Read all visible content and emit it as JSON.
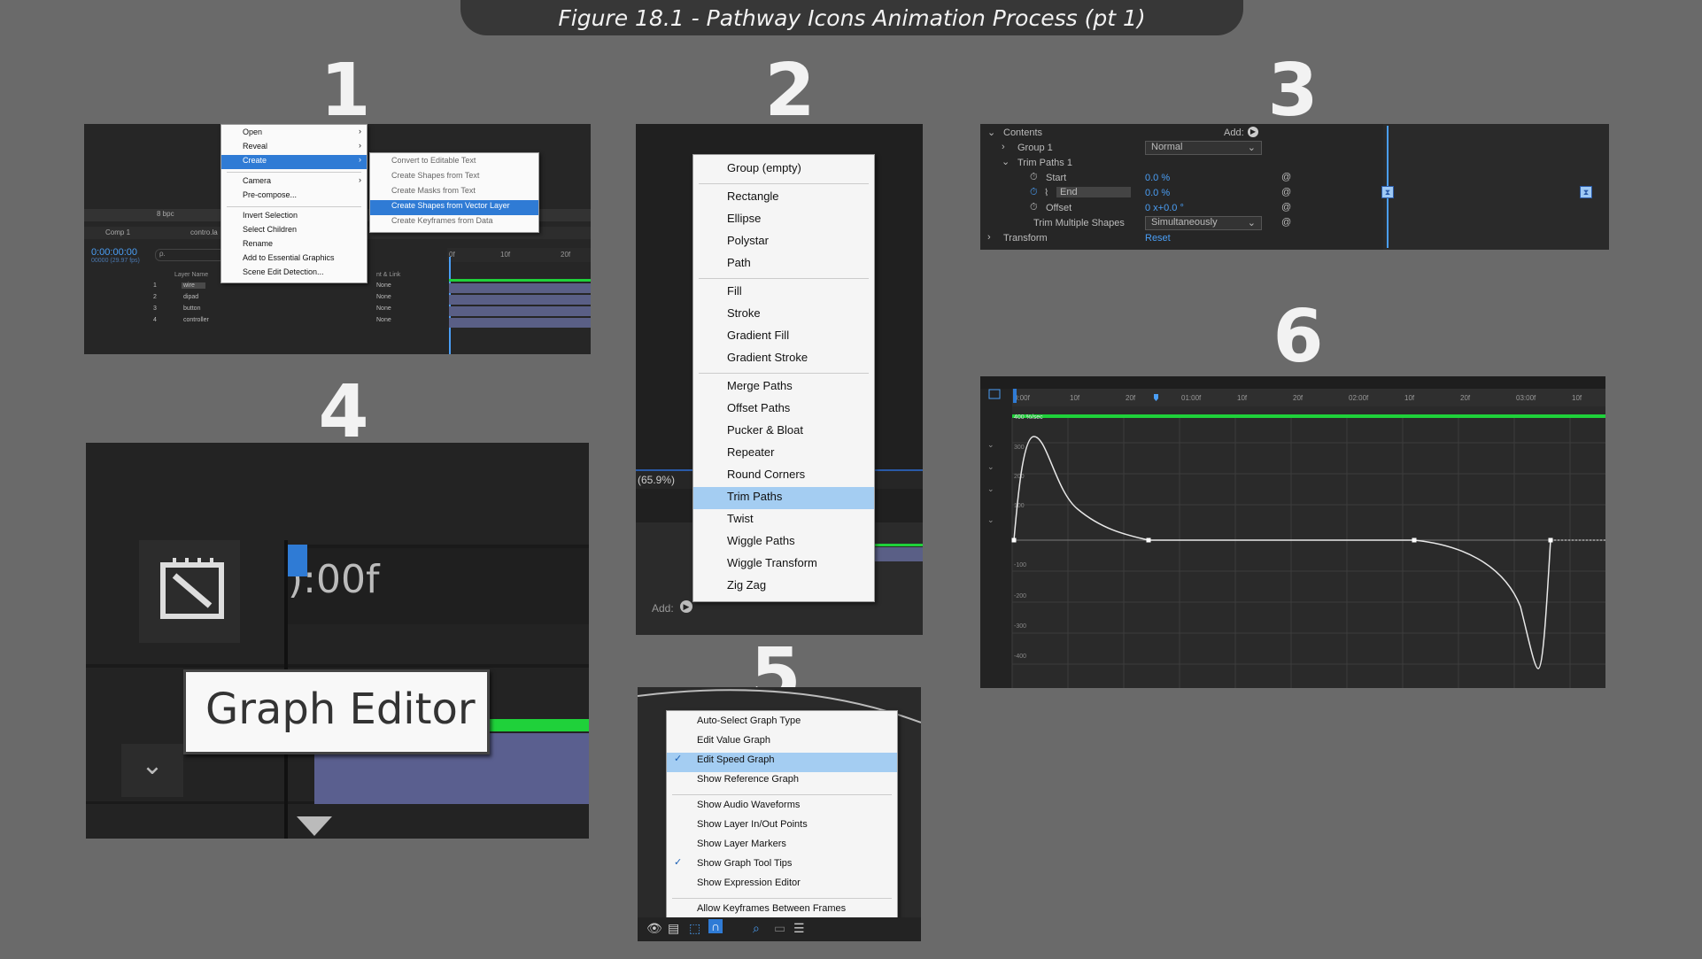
{
  "title": "Figure 18.1 - Pathway Icons Animation Process (pt 1)",
  "steps": [
    "1",
    "2",
    "3",
    "4",
    "5",
    "6"
  ],
  "panel1": {
    "context_menu": [
      "Open",
      "Reveal",
      "Create",
      "Camera",
      "Pre-compose...",
      "Invert Selection",
      "Select Children",
      "Rename",
      "Add to Essential Graphics",
      "Scene Edit Detection..."
    ],
    "submenu": [
      "Convert to Editable Text",
      "Create Shapes from Text",
      "Create Masks from Text",
      "Create Shapes from Vector Layer",
      "Create Keyframes from Data"
    ],
    "highlight_item": "Create",
    "highlight_sub": "Create Shapes from Vector Layer",
    "tabs": [
      "Comp 1",
      "contro.la"
    ],
    "timecode": "0:00:00:00",
    "timecode_sub": "00000 (29.97 fps)",
    "search_placeholder": "ρ.",
    "column_layer_name": "Layer Name",
    "column_parent": "nt & Link",
    "ruler": [
      "0f",
      "10f",
      "20f"
    ],
    "layers": [
      {
        "num": "1",
        "name": "wire",
        "parent": "None"
      },
      {
        "num": "2",
        "name": "dipad",
        "parent": "None"
      },
      {
        "num": "3",
        "name": "button",
        "parent": "None"
      },
      {
        "num": "4",
        "name": "controller",
        "parent": "None"
      }
    ],
    "bpc": "8 bpc"
  },
  "panel2": {
    "items": [
      "Group (empty)",
      "Rectangle",
      "Ellipse",
      "Polystar",
      "Path",
      "Fill",
      "Stroke",
      "Gradient Fill",
      "Gradient Stroke",
      "Merge Paths",
      "Offset Paths",
      "Pucker & Bloat",
      "Repeater",
      "Round Corners",
      "Trim Paths",
      "Twist",
      "Wiggle Paths",
      "Wiggle Transform",
      "Zig Zag"
    ],
    "highlight": "Trim Paths",
    "zoom_label": "(65.9%)",
    "add_label": "Add:"
  },
  "panel3": {
    "contents_label": "Contents",
    "add_label": "Add:",
    "group_label": "Group 1",
    "blend_mode": "Normal",
    "trim_label": "Trim Paths 1",
    "start_label": "Start",
    "start_value": "0.0 %",
    "end_label": "End",
    "end_value": "0.0 %",
    "offset_label": "Offset",
    "offset_value": "0 x+0.0 °",
    "trim_multiple_label": "Trim Multiple Shapes",
    "trim_multiple_value": "Simultaneously",
    "transform_label": "Transform",
    "reset_label": "Reset"
  },
  "panel4": {
    "tooltip": "Graph Editor",
    "timecode_fragment": "):00f"
  },
  "panel5": {
    "items": [
      {
        "label": "Auto-Select Graph Type",
        "checked": false
      },
      {
        "label": "Edit Value Graph",
        "checked": false
      },
      {
        "label": "Edit Speed Graph",
        "checked": true
      },
      {
        "label": "Show Reference Graph",
        "checked": false
      },
      {
        "label": "Show Audio Waveforms",
        "checked": false
      },
      {
        "label": "Show Layer In/Out Points",
        "checked": false
      },
      {
        "label": "Show Layer Markers",
        "checked": false
      },
      {
        "label": "Show Graph Tool Tips",
        "checked": true
      },
      {
        "label": "Show Expression Editor",
        "checked": false
      },
      {
        "label": "Allow Keyframes Between Frames",
        "checked": false
      }
    ],
    "highlight": "Edit Speed Graph"
  },
  "panel6": {
    "ruler": [
      "0:00f",
      "10f",
      "20f",
      "01:00f",
      "10f",
      "20f",
      "02:00f",
      "10f",
      "20f",
      "03:00f",
      "10f"
    ],
    "y_ticks": [
      "300",
      "200",
      "100",
      "-100",
      "-200",
      "-300",
      "-400"
    ],
    "top_label": "400 %/sec",
    "curve_color": "#e8e8e8",
    "accent": "#1fd13a"
  }
}
